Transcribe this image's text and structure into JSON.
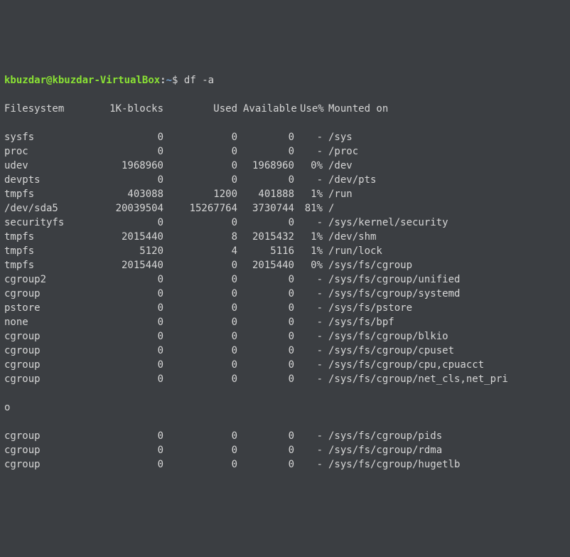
{
  "prompt": {
    "user": "kbuzdar",
    "at": "@",
    "host": "kbuzdar-VirtualBox",
    "colon": ":",
    "path": "~",
    "dollar": "$ ",
    "command": "df -a"
  },
  "headers": {
    "filesystem": "Filesystem",
    "blocks": "1K-blocks",
    "used": "Used",
    "available": "Available",
    "usep": "Use%",
    "mounted": "Mounted on"
  },
  "rows": [
    {
      "fs": "sysfs",
      "blocks": "0",
      "used": "0",
      "avail": "0",
      "usep": "-",
      "mount": "/sys"
    },
    {
      "fs": "proc",
      "blocks": "0",
      "used": "0",
      "avail": "0",
      "usep": "-",
      "mount": "/proc"
    },
    {
      "fs": "udev",
      "blocks": "1968960",
      "used": "0",
      "avail": "1968960",
      "usep": "0%",
      "mount": "/dev"
    },
    {
      "fs": "devpts",
      "blocks": "0",
      "used": "0",
      "avail": "0",
      "usep": "-",
      "mount": "/dev/pts"
    },
    {
      "fs": "tmpfs",
      "blocks": "403088",
      "used": "1200",
      "avail": "401888",
      "usep": "1%",
      "mount": "/run"
    },
    {
      "fs": "/dev/sda5",
      "blocks": "20039504",
      "used": "15267764",
      "avail": "3730744",
      "usep": "81%",
      "mount": "/"
    },
    {
      "fs": "securityfs",
      "blocks": "0",
      "used": "0",
      "avail": "0",
      "usep": "-",
      "mount": "/sys/kernel/security"
    },
    {
      "fs": "tmpfs",
      "blocks": "2015440",
      "used": "8",
      "avail": "2015432",
      "usep": "1%",
      "mount": "/dev/shm"
    },
    {
      "fs": "tmpfs",
      "blocks": "5120",
      "used": "4",
      "avail": "5116",
      "usep": "1%",
      "mount": "/run/lock"
    },
    {
      "fs": "tmpfs",
      "blocks": "2015440",
      "used": "0",
      "avail": "2015440",
      "usep": "0%",
      "mount": "/sys/fs/cgroup"
    },
    {
      "fs": "cgroup2",
      "blocks": "0",
      "used": "0",
      "avail": "0",
      "usep": "-",
      "mount": "/sys/fs/cgroup/unified"
    },
    {
      "fs": "cgroup",
      "blocks": "0",
      "used": "0",
      "avail": "0",
      "usep": "-",
      "mount": "/sys/fs/cgroup/systemd"
    },
    {
      "fs": "pstore",
      "blocks": "0",
      "used": "0",
      "avail": "0",
      "usep": "-",
      "mount": "/sys/fs/pstore"
    },
    {
      "fs": "none",
      "blocks": "0",
      "used": "0",
      "avail": "0",
      "usep": "-",
      "mount": "/sys/fs/bpf"
    },
    {
      "fs": "cgroup",
      "blocks": "0",
      "used": "0",
      "avail": "0",
      "usep": "-",
      "mount": "/sys/fs/cgroup/blkio"
    },
    {
      "fs": "cgroup",
      "blocks": "0",
      "used": "0",
      "avail": "0",
      "usep": "-",
      "mount": "/sys/fs/cgroup/cpuset"
    },
    {
      "fs": "cgroup",
      "blocks": "0",
      "used": "0",
      "avail": "0",
      "usep": "-",
      "mount": "/sys/fs/cgroup/cpu,cpuacct"
    },
    {
      "fs": "cgroup",
      "blocks": "0",
      "used": "0",
      "avail": "0",
      "usep": "-",
      "mount": "/sys/fs/cgroup/net_cls,net_pri"
    }
  ],
  "wrap_char": "o",
  "rows2": [
    {
      "fs": "cgroup",
      "blocks": "0",
      "used": "0",
      "avail": "0",
      "usep": "-",
      "mount": "/sys/fs/cgroup/pids"
    },
    {
      "fs": "cgroup",
      "blocks": "0",
      "used": "0",
      "avail": "0",
      "usep": "-",
      "mount": "/sys/fs/cgroup/rdma"
    },
    {
      "fs": "cgroup",
      "blocks": "0",
      "used": "0",
      "avail": "0",
      "usep": "-",
      "mount": "/sys/fs/cgroup/hugetlb"
    }
  ]
}
